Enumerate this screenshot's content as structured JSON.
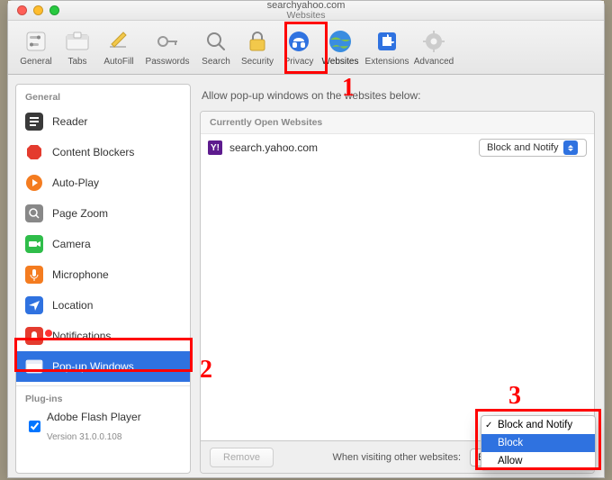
{
  "window": {
    "path": "searchyahoo.com",
    "title": "Websites"
  },
  "toolbar": {
    "items": [
      {
        "label": "General"
      },
      {
        "label": "Tabs"
      },
      {
        "label": "AutoFill"
      },
      {
        "label": "Passwords"
      },
      {
        "label": "Search"
      },
      {
        "label": "Security"
      },
      {
        "label": "Privacy"
      },
      {
        "label": "Websites"
      },
      {
        "label": "Extensions"
      },
      {
        "label": "Advanced"
      }
    ]
  },
  "sidebar": {
    "sections": {
      "general": "General",
      "plugins": "Plug-ins"
    },
    "items": [
      {
        "label": "Reader"
      },
      {
        "label": "Content Blockers"
      },
      {
        "label": "Auto-Play"
      },
      {
        "label": "Page Zoom"
      },
      {
        "label": "Camera"
      },
      {
        "label": "Microphone"
      },
      {
        "label": "Location"
      },
      {
        "label": "Notifications"
      },
      {
        "label": "Pop-up Windows"
      }
    ],
    "plugin": {
      "name": "Adobe Flash Player",
      "version": "Version 31.0.0.108"
    }
  },
  "main": {
    "header": "Allow pop-up windows on the websites below:",
    "list_caption": "Currently Open Websites",
    "rows": [
      {
        "site": "search.yahoo.com",
        "policy": "Block and Notify"
      }
    ],
    "remove_label": "Remove",
    "other_label": "When visiting other websites:"
  },
  "dropdown": {
    "options": [
      "Block and Notify",
      "Block",
      "Allow"
    ],
    "checked": "Block and Notify",
    "highlighted": "Block"
  },
  "annotations": {
    "n1": "1",
    "n2": "2",
    "n3": "3"
  }
}
